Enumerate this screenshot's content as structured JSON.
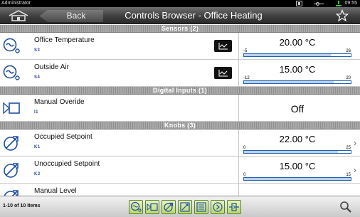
{
  "status_bar": {
    "user": "Administrator",
    "time": "09:55"
  },
  "nav": {
    "back_label": "Back",
    "title": "Controls Browser - Office Heating"
  },
  "sections": {
    "sensors": "Sensors (2)",
    "digital_inputs": "Digital Inputs (1)",
    "knobs": "Knobs (3)"
  },
  "sensors": [
    {
      "name": "Office Temperature",
      "id": "S3",
      "value": "20.00 °C",
      "min": "-5",
      "max": "26",
      "level": 0.81
    },
    {
      "name": "Outside Air",
      "id": "S4",
      "value": "15.00 °C",
      "min": "-12",
      "max": "20",
      "level": 0.84
    }
  ],
  "digital_inputs": [
    {
      "name": "Manual Overide",
      "id": "I1",
      "state": "Off"
    }
  ],
  "knobs": [
    {
      "name": "Occupied Setpoint",
      "id": "K1",
      "value": "22.00 °C",
      "min": "0",
      "max": "25",
      "level": 0.88
    },
    {
      "name": "Unoccupied Setpoint",
      "id": "K2",
      "value": "15.00 °C",
      "min": "0",
      "max": "15",
      "level": 1.0
    },
    {
      "name": "Manual Level",
      "id": "",
      "value": "",
      "min": "",
      "max": "",
      "level": 0
    }
  ],
  "footer": {
    "count": "1-10 of 10 Items"
  },
  "icons": {
    "home": "home-icon",
    "favorite": "star-icon",
    "trend": "trend-chart-icon",
    "sensor": "sensor-icon",
    "digital_input": "digital-input-icon",
    "knob": "knob-icon",
    "search": "search-icon"
  },
  "colors": {
    "bar_border": "#1f62b5",
    "bar_fill": "#bcd0ea",
    "filter_green": "#b9d86a",
    "id_blue": "#2a4a9a"
  }
}
